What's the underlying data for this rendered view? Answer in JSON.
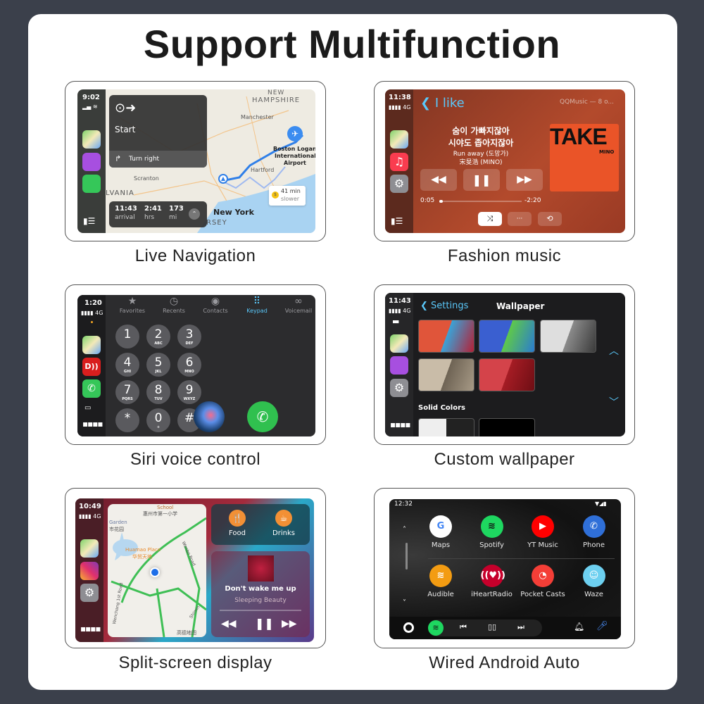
{
  "title": "Support Multifunction",
  "features": [
    {
      "caption": "Live Navigation"
    },
    {
      "caption": "Fashion music"
    },
    {
      "caption": "Siri voice control"
    },
    {
      "caption": "Custom wallpaper"
    },
    {
      "caption": "Split-screen display"
    },
    {
      "caption": "Wired Android Auto"
    }
  ],
  "nav": {
    "time": "9:02",
    "start": "Start",
    "turn": "Turn right",
    "places": [
      "NEW",
      "HAMPSHIRE",
      "Manchester",
      "Boston Logan",
      "International",
      "Airport",
      "Hartford",
      "Scranton",
      "LVANIA",
      "New York",
      "RSEY"
    ],
    "alt_route": {
      "time": "41 min",
      "note": "slower"
    },
    "eta": [
      {
        "value": "11:43",
        "label": "arrival"
      },
      {
        "value": "2:41",
        "label": "hrs"
      },
      {
        "value": "173",
        "label": "mi"
      }
    ],
    "route_color": "#2f7fe8"
  },
  "music": {
    "time": "11:38",
    "network": "4G",
    "back_label": "I like",
    "source": "QQMusic — 8 o...",
    "lyrics": [
      "숨이 가빠지잖아",
      "시야도 좁아지잖아"
    ],
    "song": "Run away (도망가)",
    "artist": "宋旻浩 (MINO)",
    "album_title": "TAKE",
    "album_sub": "MINO",
    "elapsed": "0:05",
    "remaining": "-2:20",
    "progress_pct": 4,
    "more": "···"
  },
  "phone": {
    "time": "1:20",
    "network": "4G",
    "tabs": [
      {
        "label": "Favorites",
        "icon": "star-icon"
      },
      {
        "label": "Recents",
        "icon": "clock-icon"
      },
      {
        "label": "Contacts",
        "icon": "contact-icon"
      },
      {
        "label": "Keypad",
        "icon": "keypad-icon",
        "active": true
      },
      {
        "label": "Voicemail",
        "icon": "voicemail-icon"
      }
    ],
    "keys": [
      {
        "d": "1",
        "l": ""
      },
      {
        "d": "2",
        "l": "ABC"
      },
      {
        "d": "3",
        "l": "DEF"
      },
      {
        "d": "4",
        "l": "GHI"
      },
      {
        "d": "5",
        "l": "JKL"
      },
      {
        "d": "6",
        "l": "MNO"
      },
      {
        "d": "7",
        "l": "PQRS"
      },
      {
        "d": "8",
        "l": "TUV"
      },
      {
        "d": "9",
        "l": "WXYZ"
      },
      {
        "d": "*",
        "l": ""
      },
      {
        "d": "0",
        "l": "+"
      },
      {
        "d": "#",
        "l": ""
      }
    ],
    "accent": "#5ac8fa",
    "call_color": "#30c04f"
  },
  "wallpaper": {
    "time": "11:43",
    "network": "4G",
    "back_label": "Settings",
    "title": "Wallpaper",
    "section": "Solid Colors",
    "accent": "#5ac8fa"
  },
  "split": {
    "time": "10:49",
    "network": "4G",
    "map_labels": [
      "School",
      "惠州市第一小学",
      "Garden",
      "市花园",
      "Huamao Place",
      "华贸天地",
      "Wenchang 1st Road",
      "Wenbo Road",
      "Shimin",
      "高德地图"
    ],
    "food": "Food",
    "drinks": "Drinks",
    "song": "Don't wake me up",
    "artist": "Sleeping Beauty"
  },
  "android": {
    "time": "12:32",
    "apps": [
      {
        "label": "Maps",
        "color": "#ffffff"
      },
      {
        "label": "Spotify",
        "color": "#1ed760"
      },
      {
        "label": "YT Music",
        "color": "#ff0000"
      },
      {
        "label": "Phone",
        "color": "#2f6fd8"
      },
      {
        "label": "Audible",
        "color": "#f39c12"
      },
      {
        "label": "iHeartRadio",
        "color": "#c6002b"
      },
      {
        "label": "Pocket Casts",
        "color": "#f43e37"
      },
      {
        "label": "Waze",
        "color": "#6dd0f0"
      }
    ]
  }
}
